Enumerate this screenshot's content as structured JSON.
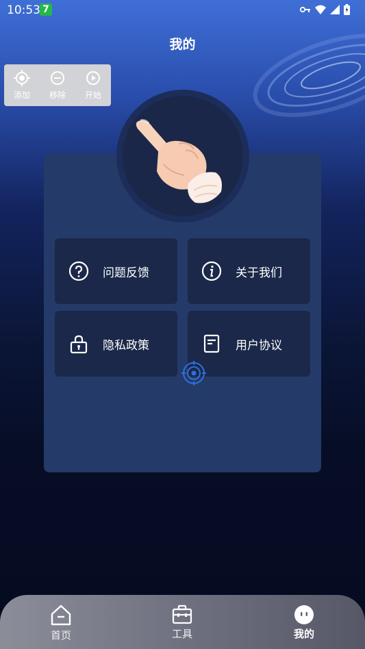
{
  "status_bar": {
    "time": "10:53",
    "badge": "7",
    "icons": [
      "key-icon",
      "wifi-icon",
      "signal-icon",
      "battery-icon"
    ]
  },
  "page": {
    "title": "我的"
  },
  "floating_toolbar": {
    "items": [
      {
        "label": "添加",
        "icon": "crosshair-icon"
      },
      {
        "label": "移除",
        "icon": "minus-circle-icon"
      },
      {
        "label": "开始",
        "icon": "play-circle-icon"
      }
    ]
  },
  "menu": {
    "items": [
      {
        "label": "问题反馈",
        "icon": "question-circle-icon"
      },
      {
        "label": "关于我们",
        "icon": "info-circle-icon"
      },
      {
        "label": "隐私政策",
        "icon": "lock-icon"
      },
      {
        "label": "用户协议",
        "icon": "document-icon"
      }
    ]
  },
  "tab_bar": {
    "tabs": [
      {
        "label": "首页",
        "icon": "home-icon",
        "active": false
      },
      {
        "label": "工具",
        "icon": "toolbox-icon",
        "active": false
      },
      {
        "label": "我的",
        "icon": "profile-face-icon",
        "active": true
      }
    ]
  },
  "colors": {
    "panel": "#243b69",
    "menu_button": "#1b2849",
    "cursor_blue": "#2f6fe0"
  }
}
